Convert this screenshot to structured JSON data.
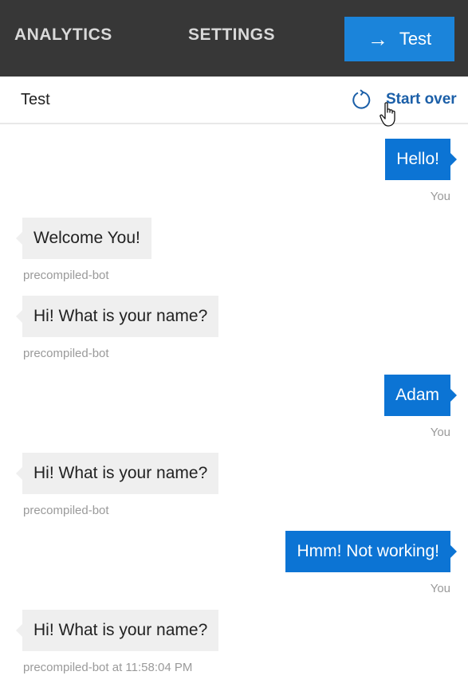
{
  "nav": {
    "analytics": "ANALYTICS",
    "settings": "SETTINGS",
    "test_button": "Test"
  },
  "panel": {
    "title": "Test",
    "start_over": "Start over"
  },
  "messages": [
    {
      "from": "user",
      "text": "Hello!",
      "meta": "You"
    },
    {
      "from": "bot",
      "text": "Welcome You!",
      "meta": "precompiled-bot"
    },
    {
      "from": "bot",
      "text": "Hi! What is your name?",
      "meta": "precompiled-bot"
    },
    {
      "from": "user",
      "text": "Adam",
      "meta": "You"
    },
    {
      "from": "bot",
      "text": "Hi! What is your name?",
      "meta": "precompiled-bot"
    },
    {
      "from": "user",
      "text": "Hmm! Not working!",
      "meta": "You"
    },
    {
      "from": "bot",
      "text": "Hi! What is your name?",
      "meta": "precompiled-bot at 11:58:04 PM"
    }
  ],
  "colors": {
    "topbar": "#373737",
    "accent": "#1b84da",
    "user_bubble": "#0c74d4",
    "bot_bubble": "#efefef"
  }
}
